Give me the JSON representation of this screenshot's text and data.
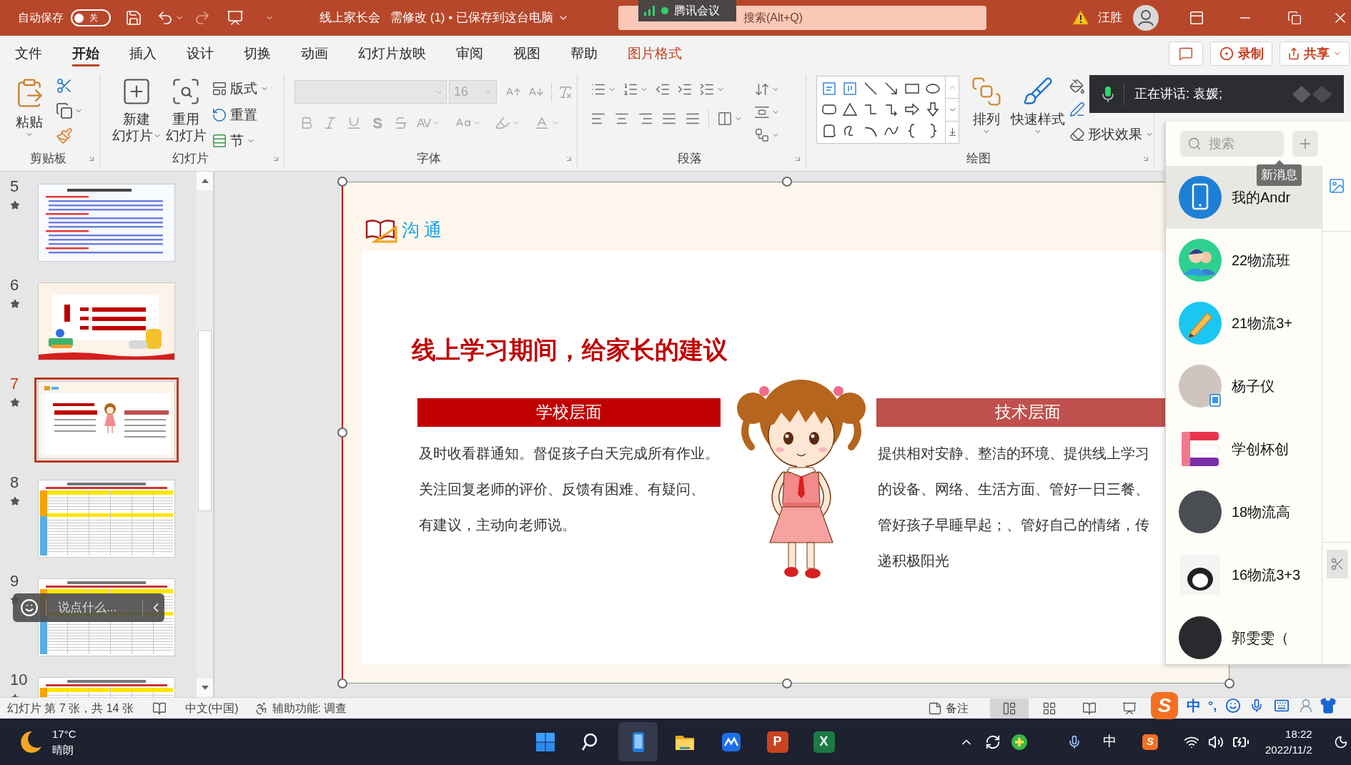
{
  "title_bar": {
    "autosave": {
      "label": "自动保存",
      "on": false,
      "state_label": "关"
    },
    "redo": {
      "disabled": true
    },
    "document_name": "线上家长会",
    "document_status": "需修改 (1) • 已保存到这台电脑",
    "search": {
      "placeholder": "搜索(Alt+Q)"
    },
    "user_name": "汪胜"
  },
  "meeting_badge": {
    "label": "腾讯会议"
  },
  "ribbon_tabs": [
    {
      "label": "文件",
      "selected": false,
      "kind": "main"
    },
    {
      "label": "开始",
      "selected": true,
      "kind": "main"
    },
    {
      "label": "插入",
      "selected": false,
      "kind": "main"
    },
    {
      "label": "设计",
      "selected": false,
      "kind": "main"
    },
    {
      "label": "切换",
      "selected": false,
      "kind": "main"
    },
    {
      "label": "动画",
      "selected": false,
      "kind": "main"
    },
    {
      "label": "幻灯片放映",
      "selected": false,
      "kind": "main"
    },
    {
      "label": "审阅",
      "selected": false,
      "kind": "main"
    },
    {
      "label": "视图",
      "selected": false,
      "kind": "main"
    },
    {
      "label": "帮助",
      "selected": false,
      "kind": "main"
    },
    {
      "label": "图片格式",
      "selected": false,
      "kind": "contextual"
    }
  ],
  "ribbon_actions": {
    "record": "录制",
    "share": "共享"
  },
  "ribbon": {
    "clipboard": {
      "label": "剪贴板",
      "paste": "粘贴"
    },
    "slides": {
      "label": "幻灯片",
      "new_slide": [
        "新建",
        "幻灯片"
      ],
      "reuse_slides": [
        "重用",
        "幻灯片"
      ],
      "layout": "版式",
      "reset": "重置",
      "section": "节"
    },
    "font": {
      "label": "字体",
      "disabled": true,
      "size": "16",
      "shadow_glyph": "S",
      "spacing_glyph": "AV"
    },
    "paragraph": {
      "label": "段落"
    },
    "drawing": {
      "label": "绘图",
      "arrange": "排列",
      "quick_styles": "快速样式",
      "shape_effects": "形状效果"
    }
  },
  "speaking_banner": {
    "text": "正在讲话: 袁媛;"
  },
  "slide_thumbnails": [
    {
      "number": "5",
      "kind": "text",
      "selected": false
    },
    {
      "number": "6",
      "kind": "agenda",
      "selected": false
    },
    {
      "number": "7",
      "kind": "advice",
      "selected": true
    },
    {
      "number": "8",
      "kind": "table",
      "selected": false
    },
    {
      "number": "9",
      "kind": "table",
      "selected": false
    },
    {
      "number": "10",
      "kind": "table",
      "selected": false
    }
  ],
  "comment_bar": {
    "placeholder": "说点什么..."
  },
  "slide": {
    "section_title": "沟通",
    "title": "线上学习期间，给家长的建议",
    "columns": [
      {
        "heading": "学校层面",
        "color": "#c00000",
        "lines": [
          "及时收看群通知。督促孩子白天完成所有作业。",
          "关注回复老师的评价、反馈有困难、有疑问、",
          "有建议，主动向老师说。"
        ]
      },
      {
        "heading": "技术层面",
        "color": "#c0504d",
        "lines": [
          "提供相对安静、整洁的环境、提供线上学习",
          "的设备、网络、生活方面、管好一日三餐、",
          "管好孩子早睡早起；、管好自己的情绪，传",
          "递积极阳光"
        ]
      }
    ]
  },
  "chat_panel": {
    "search": {
      "placeholder": "搜索"
    },
    "tooltip": "新消息",
    "contacts": [
      {
        "name": "我的Andr",
        "kind": "device",
        "selected": true
      },
      {
        "name": "22物流班",
        "kind": "group",
        "selected": false
      },
      {
        "name": "21物流3+",
        "kind": "pencil",
        "selected": false
      },
      {
        "name": "杨子仪",
        "kind": "mobile",
        "selected": false
      },
      {
        "name": "学创杯创",
        "kind": "stripes",
        "selected": false
      },
      {
        "name": "18物流高",
        "kind": "crowd",
        "selected": false
      },
      {
        "name": "16物流3+3",
        "kind": "meme",
        "selected": false
      },
      {
        "name": "郭雯雯（",
        "kind": "photo",
        "selected": false
      }
    ]
  },
  "status_bar": {
    "slide_info": "幻灯片 第 7 张，共 14 张",
    "language": "中文(中国)",
    "accessibility": "辅助功能: 调查",
    "notes": "备注",
    "views": [
      {
        "kind": "normal",
        "selected": true
      },
      {
        "kind": "sorter",
        "selected": false
      },
      {
        "kind": "reading",
        "selected": false
      },
      {
        "kind": "slideshow",
        "selected": false
      }
    ]
  },
  "ime_toolbar": {
    "logo_glyph": "S",
    "mode": "中",
    "punctuation": "°,"
  },
  "taskbar": {
    "weather": {
      "temperature": "17°C",
      "condition": "晴朗"
    },
    "apps": [
      {
        "kind": "start",
        "selected": false
      },
      {
        "kind": "search",
        "selected": false
      },
      {
        "kind": "meeting",
        "selected": true
      },
      {
        "kind": "explorer",
        "selected": false
      },
      {
        "kind": "cloud",
        "selected": false
      },
      {
        "kind": "powerpoint",
        "glyph": "P",
        "selected": false
      },
      {
        "kind": "excel",
        "glyph": "X",
        "selected": false
      }
    ],
    "tray": {
      "ime_mode": "中",
      "ime_glyph": "S",
      "time": "18:22",
      "date": "2022/11/2"
    }
  }
}
